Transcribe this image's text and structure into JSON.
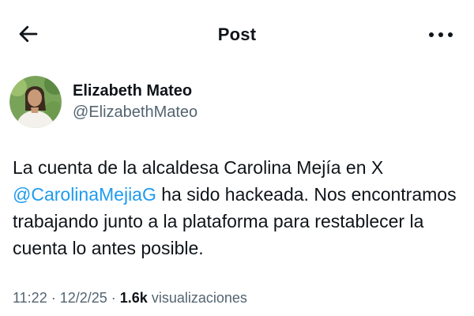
{
  "header": {
    "title": "Post",
    "back_icon": "arrow-left-icon",
    "more_icon": "more-horizontal-icon"
  },
  "author": {
    "name": "Elizabeth Mateo",
    "handle": "@ElizabethMateo"
  },
  "post": {
    "text_before": "La cuenta de la alcaldesa Carolina Mejía en X ",
    "mention": "@CarolinaMejiaG",
    "text_after": " ha sido hackeada. Nos encontramos trabajando junto a la plataforma para restablecer la cuenta lo antes posible."
  },
  "meta": {
    "time": "11:22",
    "sep1": " · ",
    "date": "12/2/25",
    "sep2": " · ",
    "views_count": "1.6k",
    "views_label": " visualizaciones"
  },
  "colors": {
    "link": "#1d9bf0",
    "secondary_text": "#536471",
    "primary_text": "#0f1419"
  }
}
